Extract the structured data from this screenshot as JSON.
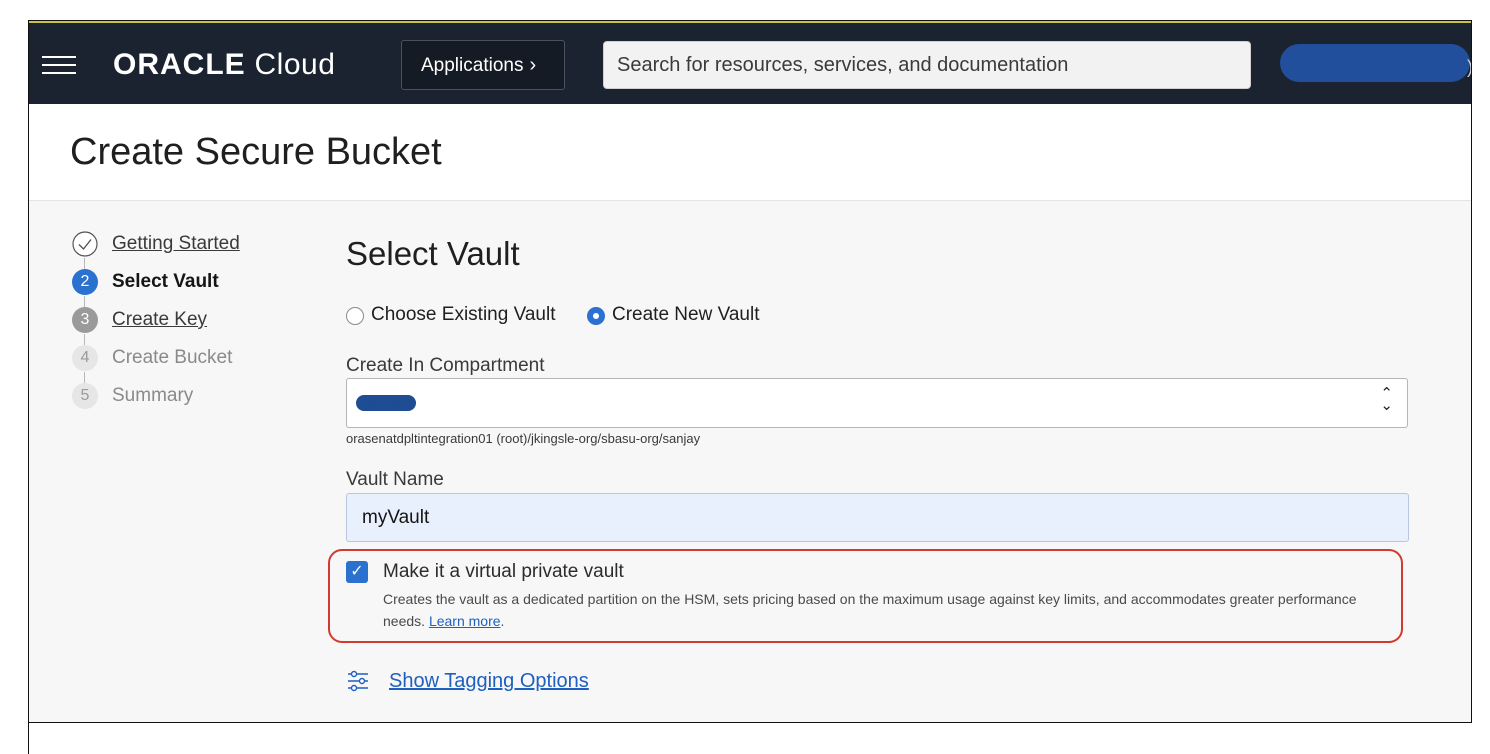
{
  "topbar": {
    "logo_brand": "ORACLE",
    "logo_product": "Cloud",
    "applications_label": "Applications",
    "search_placeholder": "Search for resources, services, and documentation",
    "user_edge": ")"
  },
  "header": {
    "title": "Create Secure Bucket"
  },
  "steps": [
    {
      "number": "",
      "label": "Getting Started",
      "state": "completed"
    },
    {
      "number": "2",
      "label": "Select Vault",
      "state": "current"
    },
    {
      "number": "3",
      "label": "Create Key",
      "state": "available"
    },
    {
      "number": "4",
      "label": "Create Bucket",
      "state": "disabled"
    },
    {
      "number": "5",
      "label": "Summary",
      "state": "disabled"
    }
  ],
  "form": {
    "section_title": "Select Vault",
    "radio_existing": "Choose Existing Vault",
    "radio_new": "Create New Vault",
    "selected_radio": "Create New Vault",
    "compartment_label": "Create In Compartment",
    "compartment_value": "sanjay",
    "compartment_path": "orasenatdpltintegration01 (root)/jkingsle-org/sbasu-org/sanjay",
    "vault_name_label": "Vault Name",
    "vault_name_value": "myVault",
    "virtual_private_label": "Make it a virtual private vault",
    "virtual_private_checked": true,
    "virtual_private_desc": "Creates the vault as a dedicated partition on the HSM, sets pricing based on the maximum usage against key limits, and accommodates greater performance needs.",
    "learn_more": "Learn more",
    "learn_more_suffix": ".",
    "tagging_link": "Show Tagging Options"
  },
  "colors": {
    "topbar": "#1b2330",
    "accent": "#2b72d0",
    "highlight_border": "#d33a2f",
    "link": "#1f5fbf"
  }
}
